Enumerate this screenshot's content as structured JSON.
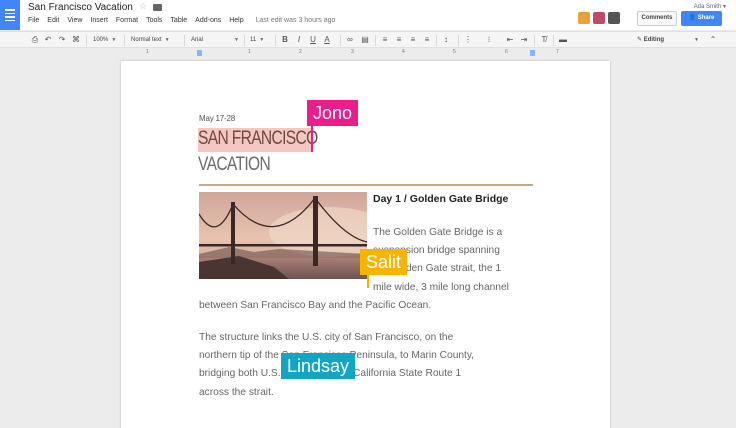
{
  "header": {
    "doc_title": "San Francisco Vacation",
    "menu": [
      "File",
      "Edit",
      "View",
      "Insert",
      "Format",
      "Tools",
      "Table",
      "Add-ons",
      "Help"
    ],
    "last_edit": "Last edit was 3 hours ago",
    "user_name": "Ada Smith",
    "comments_label": "Comments",
    "share_label": "Share",
    "avatar_colors": [
      "#e8a23a",
      "#c04b6a",
      "#555555"
    ]
  },
  "toolbar": {
    "zoom": "100%",
    "style": "Normal text",
    "font": "Arial",
    "size": "11",
    "mode": "Editing"
  },
  "ruler": {
    "numbers": [
      "1",
      "1",
      "2",
      "3",
      "4",
      "5",
      "6",
      "7"
    ]
  },
  "document": {
    "date": "May 17-28",
    "title_line1": "SAN FRANCISCO",
    "title_line2": "VACATION",
    "day_heading": "Day 1 / Golden Gate Bridge",
    "para1_lines": [
      "The Golden Gate Bridge is a",
      "suspension bridge spanning",
      "the Golden Gate strait, the 1",
      "mile wide, 3 mile long channel"
    ],
    "para1_tail": "between San Francisco Bay and the Pacific Ocean.",
    "para2_lines": [
      "The structure links the U.S. city of San Francisco, on the",
      "northern tip of the San Francisco Peninsula, to Marin County,",
      "bridging both U.S. Route 101 and California State Route 1",
      "across the strait."
    ]
  },
  "collaborators": [
    {
      "name": "Jono",
      "color": "#e91e8c"
    },
    {
      "name": "Salit",
      "color": "#f4b400"
    },
    {
      "name": "Lindsay",
      "color": "#12a5c4"
    }
  ]
}
